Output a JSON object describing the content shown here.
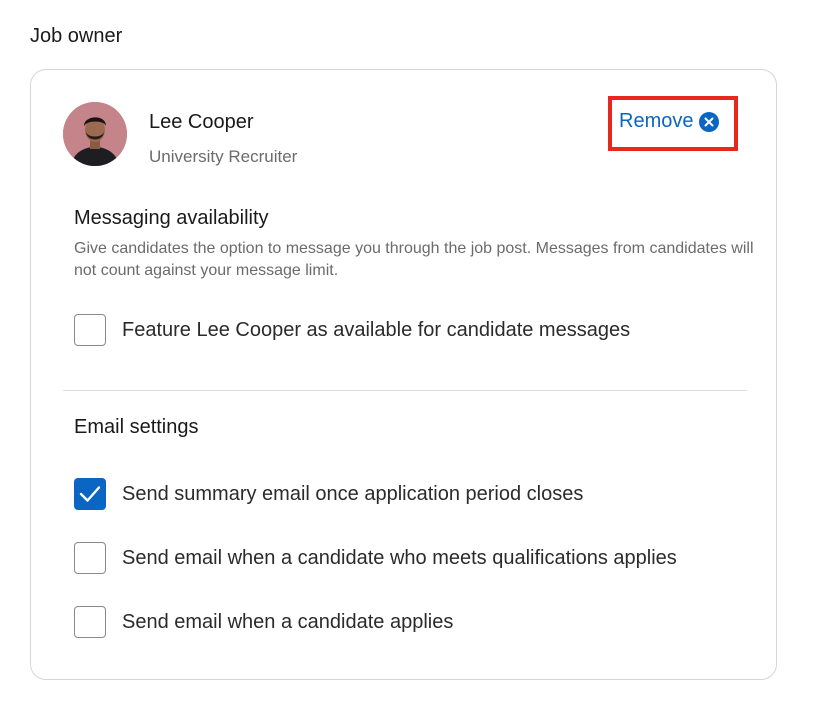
{
  "section_title": "Job owner",
  "owner": {
    "name": "Lee Cooper",
    "role": "University Recruiter"
  },
  "remove": {
    "label": "Remove",
    "icon": "close-circle-icon",
    "highlight_color": "#e8281c"
  },
  "messaging": {
    "heading": "Messaging availability",
    "description": "Give candidates the option to message you through the job post. Messages from candidates will not count against your message limit.",
    "option": {
      "label": "Feature Lee Cooper as available for candidate messages",
      "checked": false
    }
  },
  "email": {
    "heading": "Email settings",
    "options": [
      {
        "label": "Send summary email once application period closes",
        "checked": true
      },
      {
        "label": "Send email when a candidate who meets qualifications applies",
        "checked": false
      },
      {
        "label": "Send email when a candidate applies",
        "checked": false
      }
    ]
  },
  "colors": {
    "accent": "#0a66c2",
    "text": "#1a1a1a",
    "muted": "#6b6b6b"
  }
}
